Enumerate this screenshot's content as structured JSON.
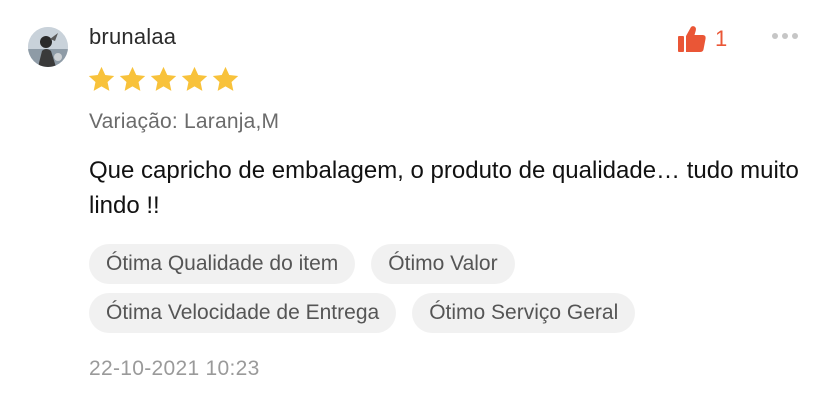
{
  "review": {
    "username": "brunalaa",
    "rating": 5,
    "rating_max": 5,
    "like_count": "1",
    "variation": "Variação: Laranja,M",
    "text": "Que capricho de embalagem, o produto de qualidade… tudo muito lindo !!",
    "tags": [
      "Ótima Qualidade do item",
      "Ótimo Valor",
      "Ótima Velocidade de Entrega",
      "Ótimo Serviço Geral"
    ],
    "date": "22-10-2021 10:23"
  },
  "colors": {
    "star": "#f8c23b",
    "like_icon": "#ea5636",
    "like_count": "#ea5636",
    "tag_bg": "#f1f1f1"
  },
  "icons": {
    "like": "thumbs-up-icon",
    "more": "more-dots-icon",
    "star": "star-icon"
  }
}
